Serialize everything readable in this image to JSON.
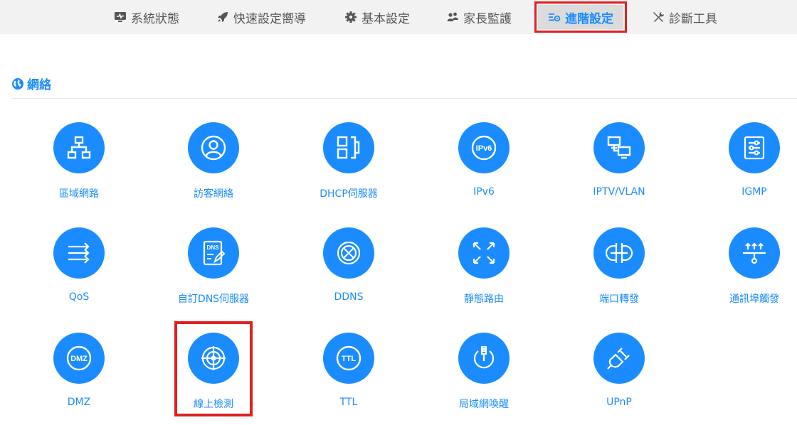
{
  "nav": {
    "items": [
      {
        "label": "系統狀態",
        "icon": "monitor-icon"
      },
      {
        "label": "快速設定嚮導",
        "icon": "rocket-icon"
      },
      {
        "label": "基本設定",
        "icon": "gear-icon"
      },
      {
        "label": "家長監護",
        "icon": "users-icon"
      },
      {
        "label": "進階設定",
        "icon": "advanced-settings-icon",
        "active": true
      },
      {
        "label": "診斷工具",
        "icon": "tools-icon"
      }
    ]
  },
  "section": {
    "title": "網絡",
    "icon": "globe-icon"
  },
  "tiles": [
    {
      "label": "區域網路",
      "icon": "lan-icon"
    },
    {
      "label": "訪客網絡",
      "icon": "guest-user-icon"
    },
    {
      "label": "DHCP伺服器",
      "icon": "dhcp-server-icon"
    },
    {
      "label": "IPv6",
      "icon": "ipv6-icon"
    },
    {
      "label": "IPTV/VLAN",
      "icon": "iptv-vlan-icon"
    },
    {
      "label": "IGMP",
      "icon": "igmp-sliders-icon"
    },
    {
      "label": "QoS",
      "icon": "qos-arrows-icon"
    },
    {
      "label": "自訂DNS伺服器",
      "icon": "dns-edit-icon"
    },
    {
      "label": "DDNS",
      "icon": "ddns-globe-icon"
    },
    {
      "label": "靜態路由",
      "icon": "static-route-icon"
    },
    {
      "label": "端口轉發",
      "icon": "port-forwarding-icon"
    },
    {
      "label": "通訊埠觸發",
      "icon": "port-trigger-icon"
    },
    {
      "label": "DMZ",
      "icon": "dmz-icon"
    },
    {
      "label": "線上檢測",
      "icon": "online-detection-icon",
      "highlighted": true
    },
    {
      "label": "TTL",
      "icon": "ttl-icon"
    },
    {
      "label": "局域網喚醒",
      "icon": "wake-on-lan-icon"
    },
    {
      "label": "UPnP",
      "icon": "upnp-plug-icon"
    }
  ],
  "colors": {
    "accent": "#1a8cff",
    "highlight": "#e02020",
    "navbar": "#f2f2f2"
  }
}
